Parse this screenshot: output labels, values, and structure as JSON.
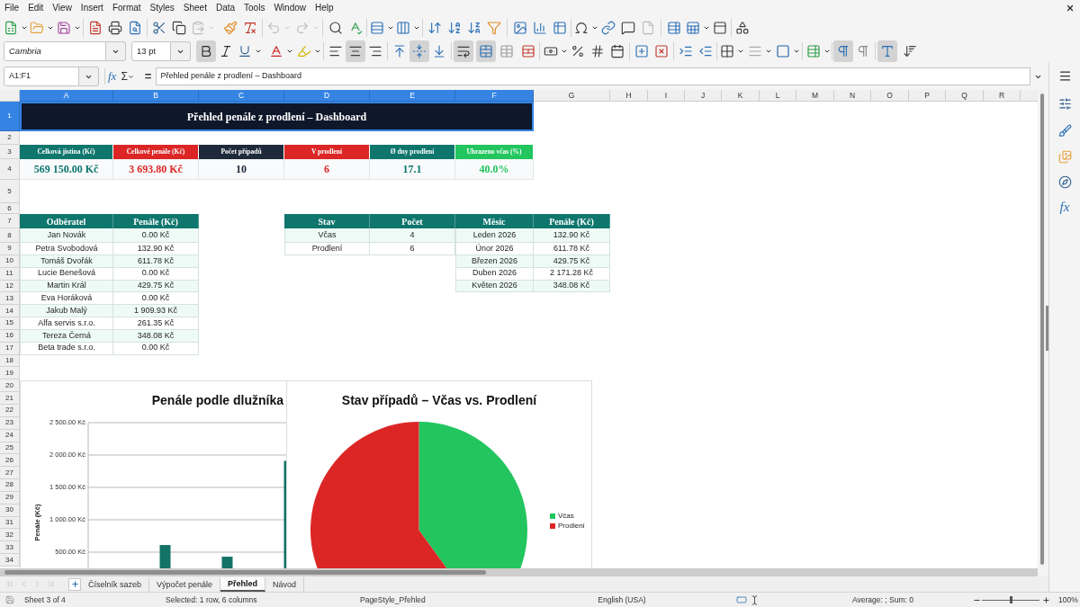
{
  "menu": [
    "File",
    "Edit",
    "View",
    "Insert",
    "Format",
    "Styles",
    "Sheet",
    "Data",
    "Tools",
    "Window",
    "Help"
  ],
  "standard_toolbar": {
    "buttons": [
      {
        "disabled": false
      },
      {
        "disabled": false
      },
      {
        "disabled": false
      },
      {
        "disabled": false
      },
      {
        "disabled": false
      },
      {
        "disabled": false
      },
      {
        "disabled": false
      },
      {
        "disabled": false
      },
      {
        "disabled": true
      },
      {
        "disabled": false
      },
      {
        "disabled": false
      },
      {
        "disabled": true
      },
      {
        "disabled": true
      },
      {
        "disabled": false
      },
      {
        "disabled": false
      },
      {
        "disabled": false
      },
      {
        "disabled": false
      },
      {
        "disabled": false
      },
      {
        "disabled": false
      },
      {
        "disabled": false
      },
      {
        "disabled": false
      },
      {
        "disabled": false
      },
      {
        "disabled": false
      },
      {
        "disabled": false
      },
      {
        "disabled": false
      },
      {
        "disabled": false
      },
      {
        "disabled": false
      },
      {
        "disabled": true
      },
      {
        "disabled": false
      },
      {
        "disabled": false
      },
      {
        "disabled": false
      },
      {
        "disabled": false
      }
    ]
  },
  "format_toolbar": {
    "font_name": "Cambria",
    "font_size": "13 pt",
    "buttons": [
      {
        "on": true
      },
      {
        "on": false
      },
      {
        "on": false
      },
      {
        "on": false
      },
      {
        "on": false
      },
      {
        "on": false
      },
      {
        "on": true
      },
      {
        "on": false
      },
      {
        "on": false
      },
      {
        "on": true
      },
      {
        "on": false
      },
      {
        "on": true
      },
      {
        "on": true
      },
      {
        "on": false
      },
      {
        "on": false
      },
      {
        "on": false
      },
      {
        "on": false
      },
      {
        "on": false
      },
      {
        "on": false
      },
      {
        "on": false
      },
      {
        "on": false
      },
      {
        "on": false
      },
      {
        "on": false
      },
      {
        "on": false
      },
      {
        "on": false
      },
      {
        "on": false
      },
      {
        "on": false
      },
      {
        "on": true
      },
      {
        "on": false
      },
      {
        "on": true
      },
      {
        "on": false
      }
    ]
  },
  "formula_bar": {
    "name_box": "A1:F1",
    "function_wizard": "fx",
    "sum": "Σ",
    "formula": "=",
    "content": "Přehled penále z prodlení – Dashboard"
  },
  "sheet": {
    "columns": [
      {
        "label": "A",
        "selected": true
      },
      {
        "label": "B",
        "selected": true
      },
      {
        "label": "C",
        "selected": true
      },
      {
        "label": "D",
        "selected": true
      },
      {
        "label": "E",
        "selected": true
      },
      {
        "label": "F",
        "selected": true
      },
      {
        "label": "G",
        "selected": false
      },
      {
        "label": "H",
        "selected": false
      },
      {
        "label": "I",
        "selected": false
      },
      {
        "label": "J",
        "selected": false
      },
      {
        "label": "K",
        "selected": false
      },
      {
        "label": "L",
        "selected": false
      },
      {
        "label": "M",
        "selected": false
      },
      {
        "label": "N",
        "selected": false
      },
      {
        "label": "O",
        "selected": false
      },
      {
        "label": "P",
        "selected": false
      },
      {
        "label": "Q",
        "selected": false
      },
      {
        "label": "R",
        "selected": false
      }
    ],
    "rows": [
      {
        "label": "1",
        "selected": true
      },
      {
        "label": "2",
        "selected": false
      },
      {
        "label": "3",
        "selected": false
      },
      {
        "label": "4",
        "selected": false
      },
      {
        "label": "5",
        "selected": false
      },
      {
        "label": "6",
        "selected": false
      },
      {
        "label": "7",
        "selected": false
      },
      {
        "label": "8",
        "selected": false
      },
      {
        "label": "9",
        "selected": false
      },
      {
        "label": "10",
        "selected": false
      },
      {
        "label": "11",
        "selected": false
      },
      {
        "label": "12",
        "selected": false
      },
      {
        "label": "13",
        "selected": false
      },
      {
        "label": "14",
        "selected": false
      },
      {
        "label": "15",
        "selected": false
      },
      {
        "label": "16",
        "selected": false
      },
      {
        "label": "17",
        "selected": false
      },
      {
        "label": "18",
        "selected": false
      },
      {
        "label": "19",
        "selected": false
      },
      {
        "label": "20",
        "selected": false
      },
      {
        "label": "21",
        "selected": false
      },
      {
        "label": "22",
        "selected": false
      },
      {
        "label": "23",
        "selected": false
      },
      {
        "label": "24",
        "selected": false
      },
      {
        "label": "25",
        "selected": false
      },
      {
        "label": "26",
        "selected": false
      },
      {
        "label": "27",
        "selected": false
      },
      {
        "label": "28",
        "selected": false
      },
      {
        "label": "29",
        "selected": false
      },
      {
        "label": "30",
        "selected": false
      },
      {
        "label": "31",
        "selected": false
      },
      {
        "label": "32",
        "selected": false
      },
      {
        "label": "33",
        "selected": false
      },
      {
        "label": "34",
        "selected": false
      }
    ],
    "title": {
      "text": "Přehled penále z prodlení – Dashboard",
      "selected": true
    },
    "kpis": [
      {
        "label": "Celková jistina (Kč)",
        "value": "569 150.00 Kč",
        "color": "#0f766e"
      },
      {
        "label": "Celkové penále (Kč)",
        "value": "3 693.80 Kč",
        "color": "#dc2626"
      },
      {
        "label": "Počet případů",
        "value": "10",
        "color": "#1e293b"
      },
      {
        "label": "V prodlení",
        "value": "6",
        "color": "#dc2626"
      },
      {
        "label": "Ø dny prodlení",
        "value": "17.1",
        "color": "#0f766e"
      },
      {
        "label": "Uhrazeno včas (%)",
        "value": "40.0%",
        "color": "#22c55e"
      }
    ],
    "debtor_table": {
      "columns": [
        "Odběratel",
        "Penále (Kč)"
      ],
      "rows": [
        [
          "Jan Novák",
          "0.00 Kč"
        ],
        [
          "Petra Svobodová",
          "132.90 Kč"
        ],
        [
          "Tomáš Dvořák",
          "611.78 Kč"
        ],
        [
          "Lucie Benešová",
          "0.00 Kč"
        ],
        [
          "Martin Král",
          "429.75 Kč"
        ],
        [
          "Eva Horáková",
          "0.00 Kč"
        ],
        [
          "Jakub Malý",
          "1 909.93 Kč"
        ],
        [
          "Alfa servis s.r.o.",
          "261.35 Kč"
        ],
        [
          "Tereza Černá",
          "348.08 Kč"
        ],
        [
          "Beta trade s.r.o.",
          "0.00 Kč"
        ]
      ]
    },
    "status_table": {
      "columns": [
        "Stav",
        "Počet"
      ],
      "rows": [
        [
          "Včas",
          "4"
        ],
        [
          "Prodlení",
          "6"
        ]
      ]
    },
    "monthly_table": {
      "columns": [
        "Měsíc",
        "Penále (Kč)"
      ],
      "rows": [
        [
          "Leden 2026",
          "132.90 Kč"
        ],
        [
          "Únor 2026",
          "611.78 Kč"
        ],
        [
          "Březen 2026",
          "429.75 Kč"
        ],
        [
          "Duben 2026",
          "2 171.28 Kč"
        ],
        [
          "Květen 2026",
          "348.08 Kč"
        ]
      ]
    },
    "charts": [
      {
        "chart_data": {
          "type": "bar",
          "title": "Penále podle dlužníka",
          "ylabel": "Penále (Kč)",
          "grid": true,
          "ylim": [
            0,
            2500
          ],
          "yticks": [
            {
              "value": 500,
              "label": "500.00 Kč"
            },
            {
              "value": 1000,
              "label": "1 000.00 Kč"
            },
            {
              "value": 1500,
              "label": "1 500.00 Kč"
            },
            {
              "value": 2000,
              "label": "2 000.00 Kč"
            },
            {
              "value": 2500,
              "label": "2 500.00 Kč"
            }
          ],
          "series": [
            {
              "color": "#137366",
              "values": [
                0,
                null,
                610,
                0,
                430,
                0,
                1910
              ]
            }
          ]
        }
      },
      {
        "legend": [
          {
            "label": "Včas",
            "color": "#22c55e"
          },
          {
            "label": "Prodlení",
            "color": "#dc2626"
          }
        ],
        "chart_data": {
          "type": "pie",
          "title": "Stav případů – Včas vs. Prodlení",
          "values": [
            40,
            60
          ]
        }
      }
    ]
  },
  "sheet_tabs": {
    "navigation": [
      {
        "disabled": true
      },
      {
        "disabled": true
      },
      {
        "disabled": true
      },
      {
        "disabled": true
      }
    ],
    "tabs": [
      {
        "label": "Číselník sazeb",
        "selected": false
      },
      {
        "label": "Výpočet penále",
        "selected": false
      },
      {
        "label": "Přehled",
        "selected": true
      },
      {
        "label": "Návod",
        "selected": false
      }
    ]
  },
  "sidebar": {
    "functions": "fx"
  },
  "status_bar": {
    "sheet": "Sheet 3 of 4",
    "selection": "Selected: 1 row, 6 columns",
    "page_style": "PageStyle_Přehled",
    "language": "English (USA)",
    "summary": "Average: ; Sum: 0",
    "zoom": {
      "level": 0.5,
      "reading": "100%"
    }
  }
}
